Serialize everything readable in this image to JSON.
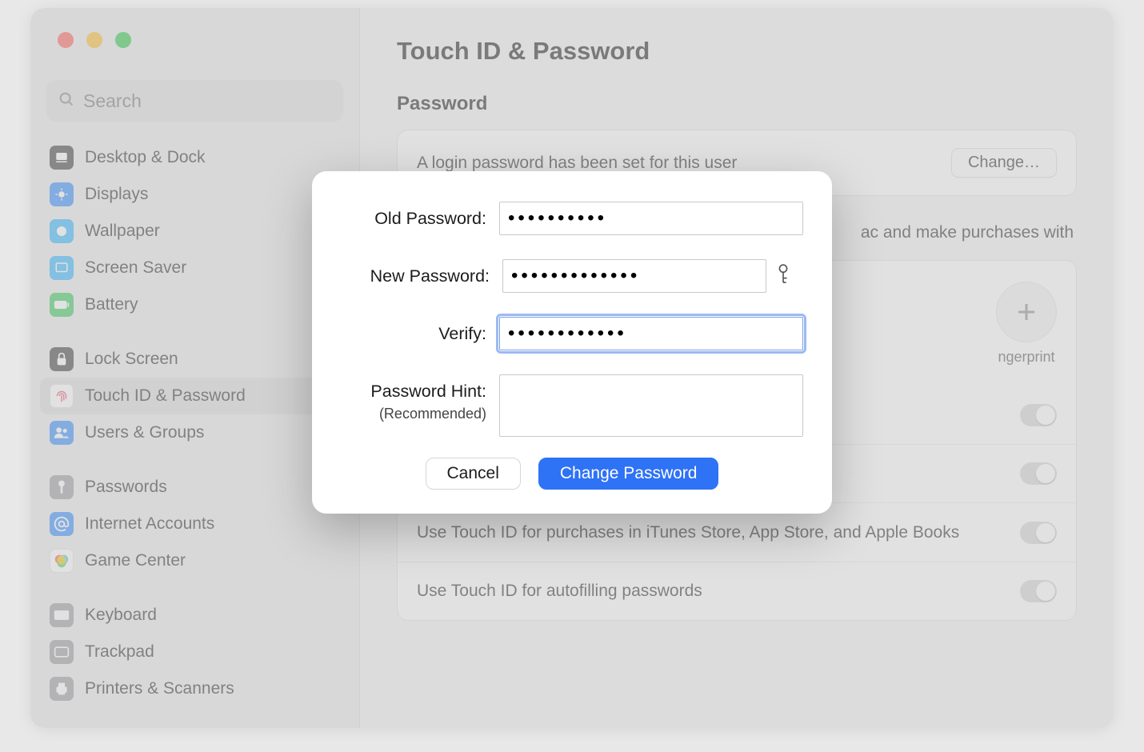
{
  "search": {
    "placeholder": "Search"
  },
  "sidebar": {
    "groups": [
      [
        {
          "label": "Desktop & Dock",
          "icon": "desktop",
          "bg": "#3b3b3d"
        },
        {
          "label": "Displays",
          "icon": "displays",
          "bg": "#2f8cff"
        },
        {
          "label": "Wallpaper",
          "icon": "wallpaper",
          "bg": "#2fb5ff"
        },
        {
          "label": "Screen Saver",
          "icon": "screensaver",
          "bg": "#2fb5ff"
        },
        {
          "label": "Battery",
          "icon": "battery",
          "bg": "#35c759"
        }
      ],
      [
        {
          "label": "Lock Screen",
          "icon": "lock",
          "bg": "#3b3b3d"
        },
        {
          "label": "Touch ID & Password",
          "icon": "fingerprint",
          "bg": "#ffffff",
          "selected": true
        },
        {
          "label": "Users & Groups",
          "icon": "users",
          "bg": "#2f8cff"
        }
      ],
      [
        {
          "label": "Passwords",
          "icon": "key",
          "bg": "#9a9a9d"
        },
        {
          "label": "Internet Accounts",
          "icon": "at",
          "bg": "#2f8cff"
        },
        {
          "label": "Game Center",
          "icon": "gamecenter",
          "bg": "#ffffff"
        }
      ],
      [
        {
          "label": "Keyboard",
          "icon": "keyboard",
          "bg": "#9a9a9d"
        },
        {
          "label": "Trackpad",
          "icon": "trackpad",
          "bg": "#9a9a9d"
        },
        {
          "label": "Printers & Scanners",
          "icon": "printer",
          "bg": "#9a9a9d"
        }
      ]
    ]
  },
  "main": {
    "title": "Touch ID & Password",
    "password_section": "Password",
    "password_status": "A login password has been set for this user",
    "change_button": "Change…",
    "touchid_desc_tail": "ac and make purchases with",
    "add_fingerprint": "ngerprint",
    "rows": [
      "Use Touch ID for purchases in iTunes Store, App Store, and Apple Books",
      "Use Touch ID for autofilling passwords"
    ]
  },
  "modal": {
    "old_label": "Old Password:",
    "new_label": "New Password:",
    "verify_label": "Verify:",
    "hint_label": "Password Hint:",
    "hint_sub": "(Recommended)",
    "old_value": "••••••••••",
    "new_value": "•••••••••••••",
    "verify_value": "••••••••••••",
    "hint_value": "",
    "cancel": "Cancel",
    "confirm": "Change Password"
  }
}
